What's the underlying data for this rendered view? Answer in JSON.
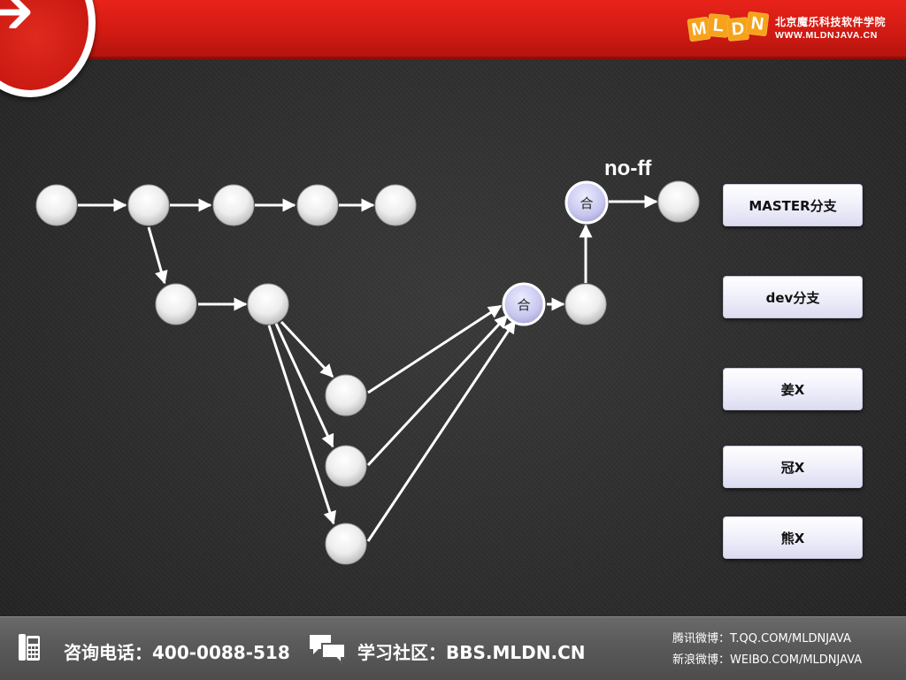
{
  "header": {
    "brand_letters": [
      "M",
      "L",
      "D",
      "N"
    ],
    "brand_name": "北京魔乐科技软件学院",
    "brand_url": "WWW.MLDNJAVA.CN",
    "accent_color": "#d91c14",
    "brand_tile_color": "#f6a31b"
  },
  "diagram": {
    "annotation": "no-ff",
    "merge_label": "合",
    "node_color": "#f2f2f2",
    "merge_node_color": "#c9c9f0",
    "edge_color": "#ffffff"
  },
  "legend": {
    "items": [
      "MASTER分支",
      "dev分支",
      "姜X",
      "冠X",
      "熊X"
    ]
  },
  "footer": {
    "phone_label": "咨询电话：400-0088-518",
    "forum_label": "学习社区：BBS.MLDN.CN",
    "tencent_weibo": "腾讯微博：T.QQ.COM/MLDNJAVA",
    "sina_weibo": "新浪微博：WEIBO.COM/MLDNJAVA"
  }
}
